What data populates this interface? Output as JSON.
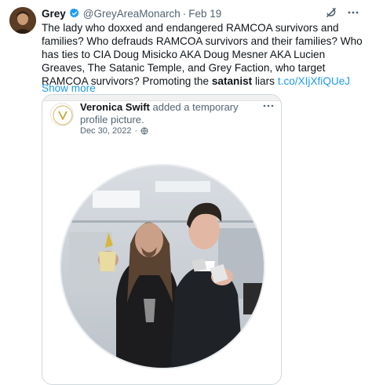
{
  "author": {
    "name": "Grey",
    "handle": "@GreyAreaMonarch",
    "separator": "·",
    "date": "Feb 19"
  },
  "icons": {
    "verified": "verified-badge-icon",
    "grok": "grok-icon",
    "more": "more-icon",
    "globe": "globe-icon"
  },
  "colors": {
    "accent": "#1d9bf0",
    "text": "#0f1419",
    "muted": "#536471"
  },
  "tweet": {
    "text_main": "The lady who doxxed and endangered RAMCOA survivors and families? Who defrauds RAMCOA survivors and their families? Who has ties to CIA Doug Misicko AKA Doug Mesner AKA Lucien Greaves, The Satanic Temple, and Grey Faction, who target RAMCOA survivors? Promoting the ",
    "text_bold": "satanist",
    "text_end": " liars",
    "link": "t.co/XIjXfiQUeJ",
    "show_more": "Show more"
  },
  "quoted": {
    "name": "Veronica Swift",
    "action": "added a temporary profile picture.",
    "date": "Dec 30, 2022",
    "separator": "·"
  }
}
